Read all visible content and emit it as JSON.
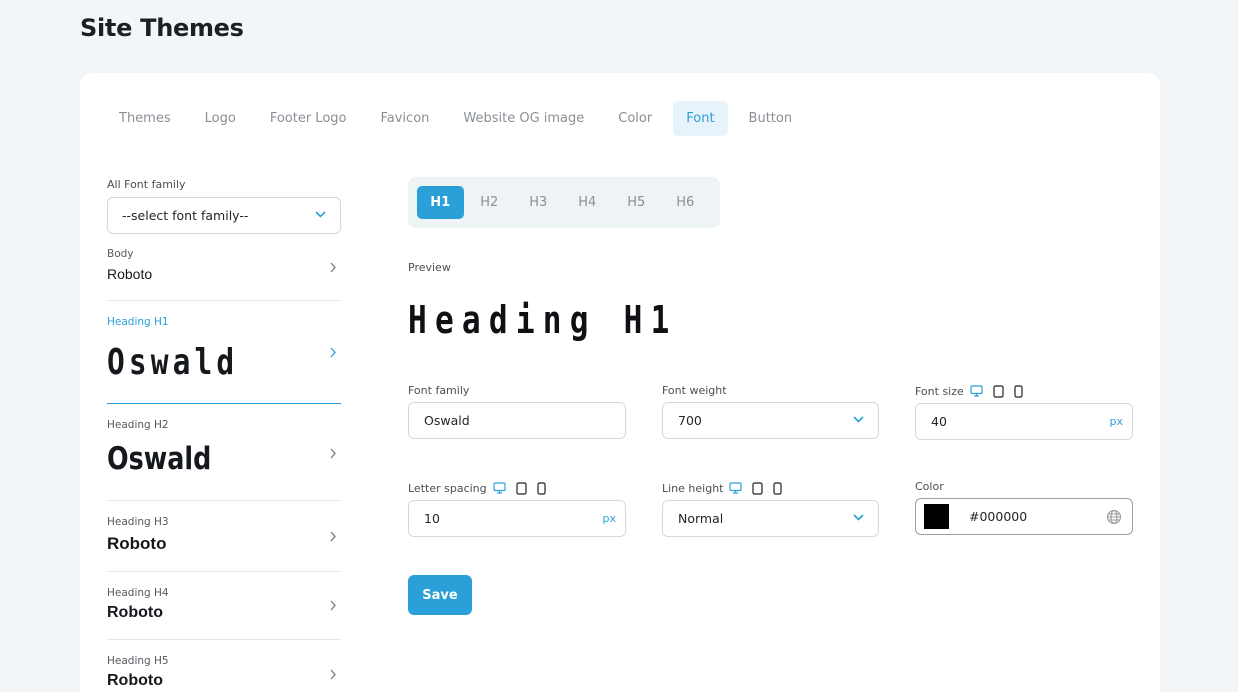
{
  "page": {
    "title": "Site Themes"
  },
  "tabs": [
    {
      "label": "Themes"
    },
    {
      "label": "Logo"
    },
    {
      "label": "Footer Logo"
    },
    {
      "label": "Favicon"
    },
    {
      "label": "Website OG image"
    },
    {
      "label": "Color"
    },
    {
      "label": "Font",
      "active": true
    },
    {
      "label": "Button"
    }
  ],
  "all_font": {
    "label": "All Font family",
    "value": "--select font family--"
  },
  "font_items": [
    {
      "label": "Body",
      "value": "Roboto"
    },
    {
      "label": "Heading H1",
      "value": "Oswald",
      "active": true
    },
    {
      "label": "Heading H2",
      "value": "Oswald"
    },
    {
      "label": "Heading H3",
      "value": "Roboto"
    },
    {
      "label": "Heading H4",
      "value": "Roboto"
    },
    {
      "label": "Heading H5",
      "value": "Roboto"
    }
  ],
  "heading_tabs": [
    "H1",
    "H2",
    "H3",
    "H4",
    "H5",
    "H6"
  ],
  "heading_active": "H1",
  "preview": {
    "label": "Preview",
    "text": "Heading H1"
  },
  "form": {
    "font_family": {
      "label": "Font family",
      "value": "Oswald"
    },
    "font_weight": {
      "label": "Font weight",
      "value": "700"
    },
    "font_size": {
      "label": "Font size",
      "value": "40",
      "unit": "px"
    },
    "letter_spacing": {
      "label": "Letter spacing",
      "value": "10",
      "unit": "px"
    },
    "line_height": {
      "label": "Line height",
      "value": "Normal"
    },
    "color": {
      "label": "Color",
      "value": "#000000",
      "swatch": "#000000"
    }
  },
  "save_label": "Save",
  "colors": {
    "accent": "#2a9fd8",
    "tab_active_bg": "#e6f3fa",
    "background": "#f2f6f9"
  },
  "icons": [
    "chevron-down-icon",
    "chevron-right-icon",
    "desktop-icon",
    "tablet-icon",
    "mobile-icon",
    "globe-icon"
  ]
}
